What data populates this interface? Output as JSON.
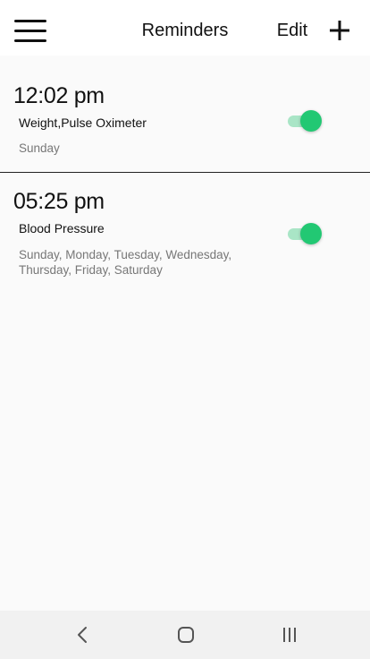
{
  "header": {
    "title": "Reminders",
    "edit_label": "Edit"
  },
  "reminders": [
    {
      "time": "12:02 pm",
      "devices": "Weight,Pulse Oximeter",
      "days": "Sunday",
      "enabled": true
    },
    {
      "time": "05:25 pm",
      "devices": "Blood Pressure",
      "days": "Sunday, Monday, Tuesday, Wednesday, Thursday, Friday, Saturday",
      "enabled": true
    }
  ],
  "icons": {
    "menu": "hamburger-menu-icon",
    "add": "plus-icon",
    "back": "chevron-left-icon",
    "home": "rounded-square-home-icon",
    "recents": "three-bars-recents-icon"
  },
  "colors": {
    "accent": "#22c873",
    "accent_track": "#a9e5c6",
    "background": "#fafafa",
    "header_bg": "#ffffff",
    "text": "#111111",
    "secondary_text": "#777777",
    "navbar_bg": "#f1f1f1"
  }
}
